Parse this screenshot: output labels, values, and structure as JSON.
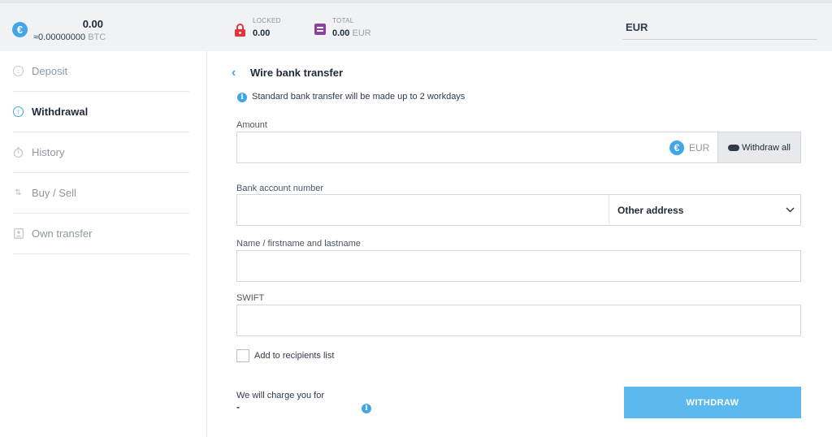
{
  "topbar": {
    "balance": "0.00",
    "balance_btc_value": "≈0.00000000",
    "balance_btc_unit": "BTC",
    "locked_label": "LOCKED",
    "locked_value": "0.00",
    "total_label": "TOTAL",
    "total_value": "0.00",
    "total_unit": "EUR",
    "currency": "EUR"
  },
  "sidebar": {
    "items": [
      {
        "label": "Deposit",
        "icon": "deposit-icon"
      },
      {
        "label": "Withdrawal",
        "icon": "withdrawal-icon",
        "active": true
      },
      {
        "label": "History",
        "icon": "stopwatch-icon"
      },
      {
        "label": "Buy / Sell",
        "icon": "swap-arrows-icon"
      },
      {
        "label": "Own transfer",
        "icon": "contact-card-icon"
      }
    ]
  },
  "main": {
    "title": "Wire bank transfer",
    "info": "Standard bank transfer will be made up to 2 workdays",
    "amount": {
      "label": "Amount",
      "value": "",
      "currency": "EUR",
      "withdraw_all": "Withdraw all"
    },
    "bank_account": {
      "label": "Bank account number",
      "value": "",
      "address_option": "Other address"
    },
    "name": {
      "label": "Name / firstname and lastname",
      "value": ""
    },
    "swift": {
      "label": "SWIFT",
      "value": ""
    },
    "recipients_checkbox": "Add to recipients list",
    "charge_label": "We will charge you for",
    "charge_value": "-",
    "submit": "WITHDRAW"
  },
  "colors": {
    "accent": "#42a5e8",
    "button": "#5bb9ee",
    "locked": "#e5323f",
    "total": "#8e3fa0"
  }
}
